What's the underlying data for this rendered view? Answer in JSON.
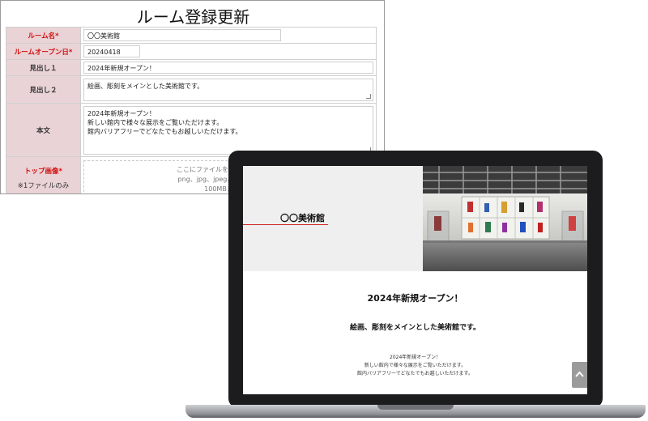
{
  "form": {
    "title": "ルーム登録更新",
    "rows": [
      {
        "label": "ルーム名*",
        "value": "〇〇美術館"
      },
      {
        "label": "ルームオープン日*",
        "value": "20240418"
      },
      {
        "label": "見出し１",
        "value": "2024年新規オープン！"
      },
      {
        "label": "見出し２",
        "value": "絵画、彫刻をメインとした美術館です。"
      },
      {
        "label": "本文",
        "value": "2024年新規オープン！\n新しい館内で様々な展示をご覧いただけます。\n館内バリアフリーでどなたでもお越しいただけます。"
      }
    ],
    "image_row": {
      "label": "トップ画像*",
      "note": "※1ファイルのみ",
      "drop_line1": "ここにファイルをドロップ　または",
      "drop_line2": "png、jpg、jpeg、gif、svgのファ",
      "drop_line3": "100MBまで対応"
    }
  },
  "site": {
    "name": "〇〇美術館",
    "heading1": "2024年新規オープン！",
    "heading2": "絵画、彫刻をメインとした美術館です。",
    "body_lines": [
      "2024年新規オープン！",
      "新しい館内で様々な展示をご覧いただけます。",
      "館内バリアフリーでどなたでもお越しいただけます。"
    ],
    "accent_color": "#d02020",
    "scroll_icon": "chevron-up-icon"
  }
}
